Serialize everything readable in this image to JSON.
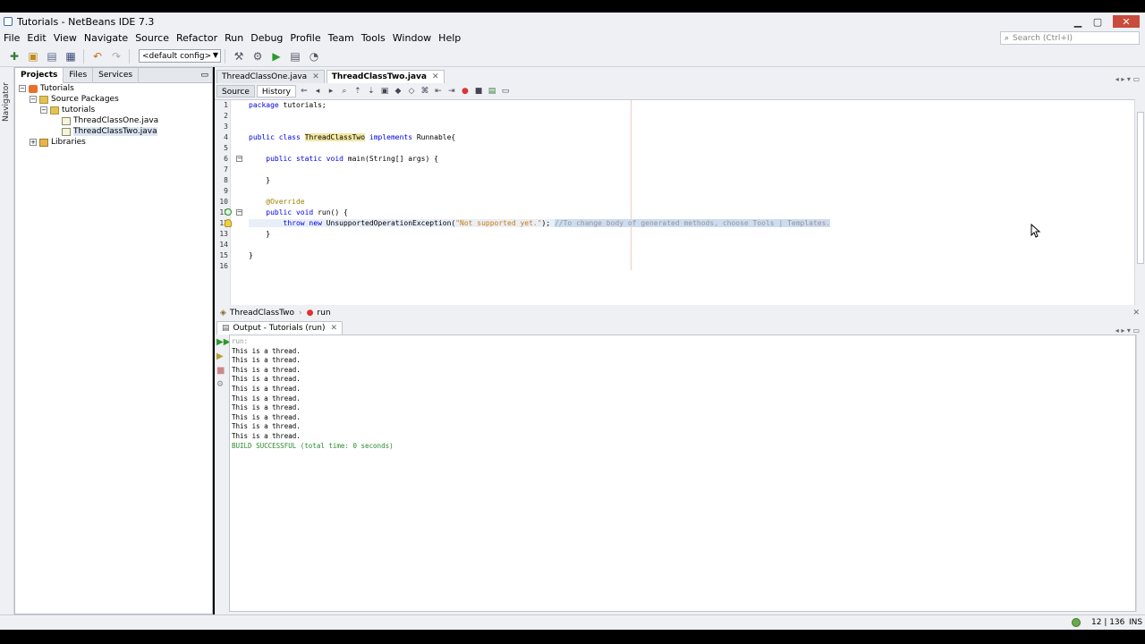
{
  "window": {
    "title": "Tutorials - NetBeans IDE 7.3"
  },
  "menu": [
    "File",
    "Edit",
    "View",
    "Navigate",
    "Source",
    "Refactor",
    "Run",
    "Debug",
    "Profile",
    "Team",
    "Tools",
    "Window",
    "Help"
  ],
  "search": {
    "placeholder": "Search (Ctrl+I)"
  },
  "toolbar": {
    "config_value": "<default config>"
  },
  "left_strip": {
    "navigator_label": "Navigator"
  },
  "projects_panel": {
    "tabs": [
      "Projects",
      "Files",
      "Services"
    ],
    "tree": [
      "Tutorials",
      "Source Packages",
      "tutorials",
      "ThreadClassOne.java",
      "ThreadClassTwo.java",
      "Libraries"
    ]
  },
  "editor": {
    "tabs": [
      "ThreadClassOne.java",
      "ThreadClassTwo.java"
    ],
    "active_tab": "ThreadClassTwo.java",
    "view_tabs": [
      "Source",
      "History"
    ],
    "line_numbers": [
      "1",
      "2",
      "3",
      "4",
      "5",
      "6",
      "7",
      "8",
      "9",
      "10",
      "11",
      "12",
      "13",
      "14",
      "15",
      "16"
    ],
    "code": {
      "l1a": "package",
      "l1b": " tutorials;",
      "l4a": "public class ",
      "l4b": "ThreadClassTwo",
      "l4c": " implements ",
      "l4d": "Runnable{",
      "l6a": "    public static void ",
      "l6b": "main(String[] args) {",
      "l8": "    }",
      "l10": "    @Override",
      "l11a": "    public void ",
      "l11b": "run() {",
      "l12a": "        throw new ",
      "l12b": "UnsupportedOperationException(",
      "l12c": "\"Not supported yet.\"",
      "l12d": "); ",
      "l12e": "//To change body of generated methods, choose Tools | Templates.",
      "l13": "    }",
      "l15": "}"
    },
    "breadcrumb": [
      "ThreadClassTwo",
      "run"
    ]
  },
  "output": {
    "tab": "Output - Tutorials (run)",
    "lines": [
      "run:",
      "This is a thread.",
      "This is a thread.",
      "This is a thread.",
      "This is a thread.",
      "This is a thread.",
      "This is a thread.",
      "This is a thread.",
      "This is a thread.",
      "This is a thread.",
      "This is a thread."
    ],
    "build": "BUILD SUCCESSFUL (total time: 0 seconds)"
  },
  "status": {
    "position": "12 | 136",
    "mode": "INS"
  },
  "colors": {
    "keyword": "#0000e6",
    "string": "#ce7b00",
    "comment": "#969696",
    "build_success": "#2a8a2a",
    "class_highlight": "#f2e8a2"
  }
}
